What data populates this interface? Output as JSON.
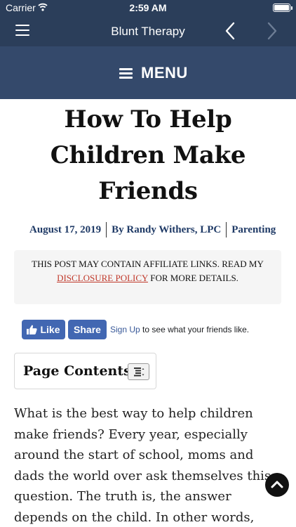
{
  "status_bar": {
    "carrier": "Carrier",
    "time": "2:59 AM",
    "icons": [
      "wifi-icon",
      "battery-icon"
    ]
  },
  "nav_bar": {
    "title": "Blunt Therapy",
    "icons": [
      "hamburger-icon",
      "back-chevron-icon",
      "forward-chevron-icon"
    ]
  },
  "menu_banner": {
    "label": "MENU",
    "icon": "menu-icon"
  },
  "article": {
    "title": "How To Help Children Make Friends",
    "date": "August 17, 2019",
    "author": "By Randy Withers, LPC",
    "category": "Parenting",
    "affiliate_notice": {
      "before": "THIS POST MAY CONTAIN AFFILIATE LINKS. READ MY",
      "link": "DISCLOSURE POLICY",
      "after": "FOR MORE DETAILS."
    },
    "body": "What is the best way to help children make friends? Every year, especially around the start of school, moms and dads the world over ask themselves this question. The truth is, the answer depends on the child. In other words, there is no cookie cuter approach if"
  },
  "facebook": {
    "like_label": "Like",
    "share_label": "Share",
    "signup_link": "Sign Up",
    "signup_text": "to see what your friends like."
  },
  "toc": {
    "title": "Page Contents",
    "toggle_icon": "list-toggle-icon"
  },
  "scroll_top": {
    "icon": "chevron-up-icon"
  },
  "colors": {
    "nav_bg": "#2b3e5a",
    "menu_bg": "#34496b",
    "meta_text": "#1f3a66",
    "link_red": "#c0392b",
    "facebook_blue": "#4267b2"
  }
}
